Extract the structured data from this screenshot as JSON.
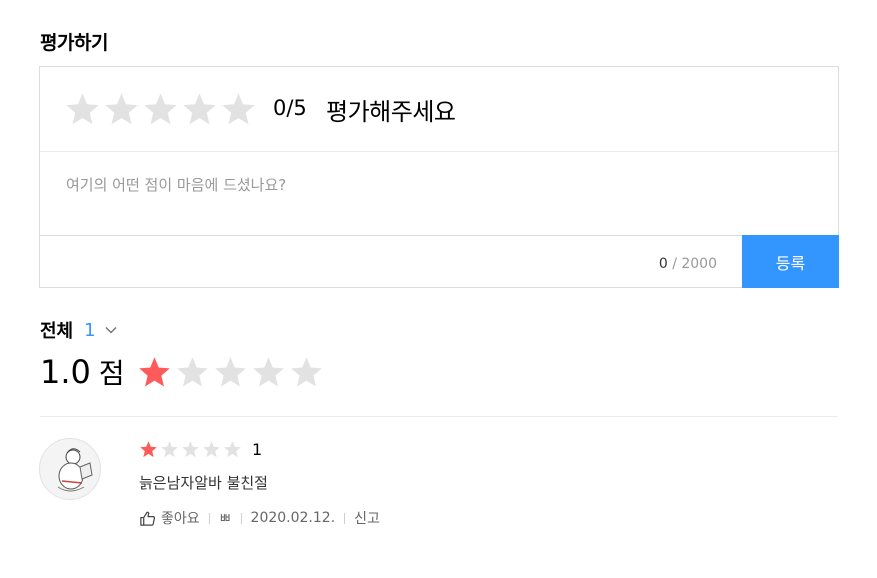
{
  "header": {
    "title": "평가하기"
  },
  "rating_form": {
    "rating_value": 0,
    "rating_max": 5,
    "score_display": "0/5",
    "prompt": "평가해주세요",
    "review_placeholder": "여기의 어떤 점이 마음에 드셨나요?",
    "char_count": "0",
    "char_limit": "/ 2000",
    "submit_label": "등록"
  },
  "reviews_summary": {
    "filter_label": "전체",
    "filter_count": "1",
    "average_score": "1.0",
    "score_unit": "점",
    "average_rating": 1
  },
  "reviews": [
    {
      "rating": 1,
      "score_text": "1",
      "text": "늙은남자알바 불친절",
      "like_label": "좋아요",
      "author": "ㅃ",
      "date": "2020.02.12.",
      "report_label": "신고"
    }
  ],
  "colors": {
    "accent": "#3396ff",
    "star_filled": "#ff5a5a",
    "star_empty": "#e2e2e2"
  }
}
